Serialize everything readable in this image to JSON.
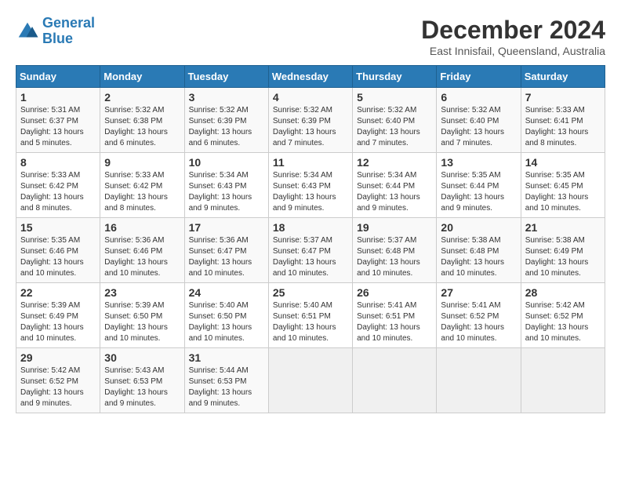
{
  "logo": {
    "line1": "General",
    "line2": "Blue"
  },
  "title": "December 2024",
  "subtitle": "East Innisfail, Queensland, Australia",
  "days_of_week": [
    "Sunday",
    "Monday",
    "Tuesday",
    "Wednesday",
    "Thursday",
    "Friday",
    "Saturday"
  ],
  "weeks": [
    [
      {
        "day": "1",
        "sunrise": "5:31 AM",
        "sunset": "6:37 PM",
        "daylight": "13 hours and 5 minutes."
      },
      {
        "day": "2",
        "sunrise": "5:32 AM",
        "sunset": "6:38 PM",
        "daylight": "13 hours and 6 minutes."
      },
      {
        "day": "3",
        "sunrise": "5:32 AM",
        "sunset": "6:39 PM",
        "daylight": "13 hours and 6 minutes."
      },
      {
        "day": "4",
        "sunrise": "5:32 AM",
        "sunset": "6:39 PM",
        "daylight": "13 hours and 7 minutes."
      },
      {
        "day": "5",
        "sunrise": "5:32 AM",
        "sunset": "6:40 PM",
        "daylight": "13 hours and 7 minutes."
      },
      {
        "day": "6",
        "sunrise": "5:32 AM",
        "sunset": "6:40 PM",
        "daylight": "13 hours and 7 minutes."
      },
      {
        "day": "7",
        "sunrise": "5:33 AM",
        "sunset": "6:41 PM",
        "daylight": "13 hours and 8 minutes."
      }
    ],
    [
      {
        "day": "8",
        "sunrise": "5:33 AM",
        "sunset": "6:42 PM",
        "daylight": "13 hours and 8 minutes."
      },
      {
        "day": "9",
        "sunrise": "5:33 AM",
        "sunset": "6:42 PM",
        "daylight": "13 hours and 8 minutes."
      },
      {
        "day": "10",
        "sunrise": "5:34 AM",
        "sunset": "6:43 PM",
        "daylight": "13 hours and 9 minutes."
      },
      {
        "day": "11",
        "sunrise": "5:34 AM",
        "sunset": "6:43 PM",
        "daylight": "13 hours and 9 minutes."
      },
      {
        "day": "12",
        "sunrise": "5:34 AM",
        "sunset": "6:44 PM",
        "daylight": "13 hours and 9 minutes."
      },
      {
        "day": "13",
        "sunrise": "5:35 AM",
        "sunset": "6:44 PM",
        "daylight": "13 hours and 9 minutes."
      },
      {
        "day": "14",
        "sunrise": "5:35 AM",
        "sunset": "6:45 PM",
        "daylight": "13 hours and 10 minutes."
      }
    ],
    [
      {
        "day": "15",
        "sunrise": "5:35 AM",
        "sunset": "6:46 PM",
        "daylight": "13 hours and 10 minutes."
      },
      {
        "day": "16",
        "sunrise": "5:36 AM",
        "sunset": "6:46 PM",
        "daylight": "13 hours and 10 minutes."
      },
      {
        "day": "17",
        "sunrise": "5:36 AM",
        "sunset": "6:47 PM",
        "daylight": "13 hours and 10 minutes."
      },
      {
        "day": "18",
        "sunrise": "5:37 AM",
        "sunset": "6:47 PM",
        "daylight": "13 hours and 10 minutes."
      },
      {
        "day": "19",
        "sunrise": "5:37 AM",
        "sunset": "6:48 PM",
        "daylight": "13 hours and 10 minutes."
      },
      {
        "day": "20",
        "sunrise": "5:38 AM",
        "sunset": "6:48 PM",
        "daylight": "13 hours and 10 minutes."
      },
      {
        "day": "21",
        "sunrise": "5:38 AM",
        "sunset": "6:49 PM",
        "daylight": "13 hours and 10 minutes."
      }
    ],
    [
      {
        "day": "22",
        "sunrise": "5:39 AM",
        "sunset": "6:49 PM",
        "daylight": "13 hours and 10 minutes."
      },
      {
        "day": "23",
        "sunrise": "5:39 AM",
        "sunset": "6:50 PM",
        "daylight": "13 hours and 10 minutes."
      },
      {
        "day": "24",
        "sunrise": "5:40 AM",
        "sunset": "6:50 PM",
        "daylight": "13 hours and 10 minutes."
      },
      {
        "day": "25",
        "sunrise": "5:40 AM",
        "sunset": "6:51 PM",
        "daylight": "13 hours and 10 minutes."
      },
      {
        "day": "26",
        "sunrise": "5:41 AM",
        "sunset": "6:51 PM",
        "daylight": "13 hours and 10 minutes."
      },
      {
        "day": "27",
        "sunrise": "5:41 AM",
        "sunset": "6:52 PM",
        "daylight": "13 hours and 10 minutes."
      },
      {
        "day": "28",
        "sunrise": "5:42 AM",
        "sunset": "6:52 PM",
        "daylight": "13 hours and 10 minutes."
      }
    ],
    [
      {
        "day": "29",
        "sunrise": "5:42 AM",
        "sunset": "6:52 PM",
        "daylight": "13 hours and 9 minutes."
      },
      {
        "day": "30",
        "sunrise": "5:43 AM",
        "sunset": "6:53 PM",
        "daylight": "13 hours and 9 minutes."
      },
      {
        "day": "31",
        "sunrise": "5:44 AM",
        "sunset": "6:53 PM",
        "daylight": "13 hours and 9 minutes."
      },
      null,
      null,
      null,
      null
    ]
  ]
}
